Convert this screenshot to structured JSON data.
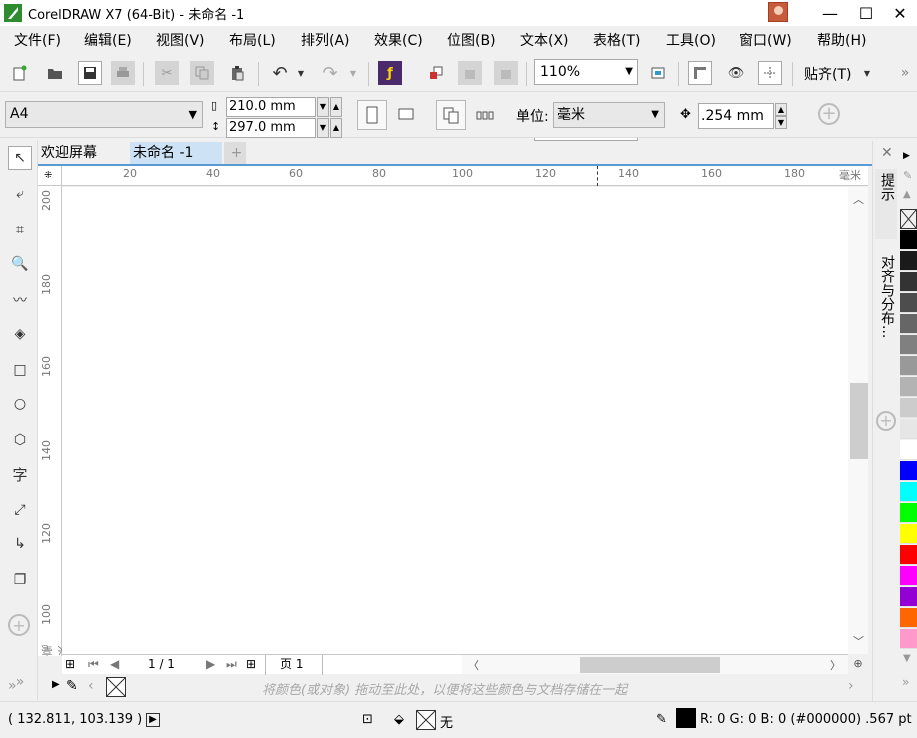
{
  "window": {
    "title": "CorelDRAW X7 (64-Bit) - 未命名 -1",
    "min_glyph": "—",
    "max_glyph": "☐",
    "close_glyph": "✕"
  },
  "menu": [
    "文件(F)",
    "编辑(E)",
    "视图(V)",
    "布局(L)",
    "排列(A)",
    "效果(C)",
    "位图(B)",
    "文本(X)",
    "表格(T)",
    "工具(O)",
    "窗口(W)",
    "帮助(H)"
  ],
  "toolbar": {
    "zoom_value": "110%",
    "snap_label": "贴齐(T)"
  },
  "propbar": {
    "page_size": "A4",
    "width_value": "210.0 mm",
    "height_value": "297.0 mm",
    "unit_label": "单位:",
    "unit_value": "毫米",
    "nudge_value": ".254 mm"
  },
  "tabs": {
    "welcome": "欢迎屏幕",
    "document": "未命名 -1",
    "add": "+"
  },
  "ruler": {
    "h_labels": [
      "20",
      "40",
      "60",
      "80",
      "100",
      "120",
      "140",
      "160",
      "180"
    ],
    "h_unit": "毫米",
    "v_labels": [
      "200",
      "180",
      "160",
      "140",
      "120",
      "100"
    ],
    "v_unit": "毫米"
  },
  "page_nav": {
    "page_count": "1 / 1",
    "page_tab": "页 1"
  },
  "docker": {
    "hints": "提示",
    "align": "对齐与分布..."
  },
  "palette": {
    "colors": [
      "#ffffff",
      "#000000",
      "#1a1a1a",
      "#333333",
      "#4d4d4d",
      "#666666",
      "#808080",
      "#999999",
      "#b3b3b3",
      "#cccccc",
      "#e6e6e6",
      "#ffffff",
      "#0000ff",
      "#00ffff",
      "#00ff00",
      "#ffff00",
      "#ff0000",
      "#ff00ff",
      "#9400d3",
      "#ff6600",
      "#ff99cc"
    ]
  },
  "docpal": {
    "hint": "将颜色(或对象) 拖动至此处，以便将这些颜色与文档存储在一起"
  },
  "status": {
    "coords": "( 132.811, 103.139 )",
    "fill_label": "无",
    "outline_info": "R: 0 G: 0 B: 0 (#000000)  .567 pt"
  }
}
